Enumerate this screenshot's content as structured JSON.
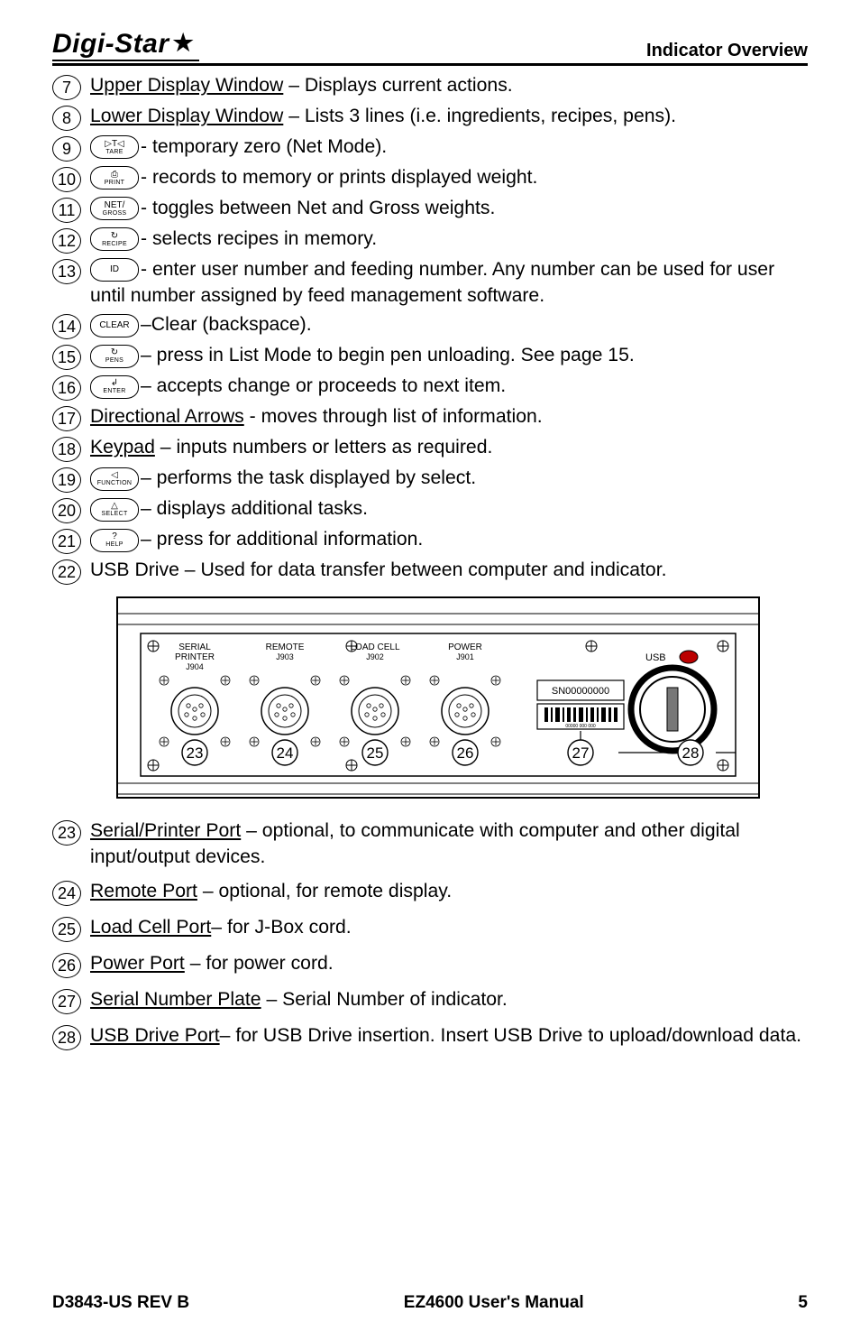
{
  "header": {
    "brand": "Digi-Star",
    "section": "Indicator Overview"
  },
  "items": [
    {
      "n": "7",
      "lead_u": "Upper Display Window",
      "sep": " – ",
      "rest": "Displays current actions.",
      "key": null
    },
    {
      "n": "8",
      "lead_u": "Lower Display Window",
      "sep": " – ",
      "rest": "Lists 3 lines (i.e. ingredients, recipes, pens).",
      "key": null
    },
    {
      "n": "9",
      "key": {
        "top": "▷T◁",
        "sub": "TARE"
      },
      "sep": "- ",
      "rest": "temporary zero (Net Mode)."
    },
    {
      "n": "10",
      "key": {
        "top": "⎙",
        "sub": "PRINT"
      },
      "sep": "- ",
      "rest": "records to memory or prints displayed weight."
    },
    {
      "n": "11",
      "key": {
        "top": "NET/",
        "sub": "GROSS"
      },
      "sep": "- ",
      "rest": "toggles between Net and Gross weights."
    },
    {
      "n": "12",
      "key": {
        "top": "↻",
        "sub": "RECIPE"
      },
      "sep": "- ",
      "rest": "selects recipes in memory."
    },
    {
      "n": "13",
      "key": {
        "top": "ID",
        "sub": ""
      },
      "sep": "- ",
      "rest": "enter user number and feeding number. Any number can be used for user until number assigned by feed management software."
    },
    {
      "n": "14",
      "key": {
        "top": "CLEAR",
        "sub": ""
      },
      "sep": "–",
      "rest": "Clear (backspace)."
    },
    {
      "n": "15",
      "key": {
        "top": "↻",
        "sub": "PENS"
      },
      "sep": "– ",
      "rest": "press in List Mode to begin pen unloading. See page 15."
    },
    {
      "n": "16",
      "key": {
        "top": "↲",
        "sub": "ENTER"
      },
      "sep": "– ",
      "rest": "accepts change or proceeds to next item."
    },
    {
      "n": "17",
      "lead_u": "Directional Arrows",
      "sep": " - ",
      "rest": "moves through list of information.",
      "key": null
    },
    {
      "n": "18",
      "lead_u": "Keypad",
      "sep": " – ",
      "rest": "inputs numbers or letters as required.",
      "key": null
    },
    {
      "n": "19",
      "key": {
        "top": "◁",
        "sub": "FUNCTION"
      },
      "sep": "– ",
      "rest": "performs the task displayed by select."
    },
    {
      "n": "20",
      "key": {
        "top": "△",
        "sub": "SELECT"
      },
      "sep": "– ",
      "rest": "displays additional tasks."
    },
    {
      "n": "21",
      "key": {
        "top": "?",
        "sub": "HELP"
      },
      "sep": "– ",
      "rest": "press for additional information."
    },
    {
      "n": "22",
      "plain": "USB Drive – Used for data transfer between computer and indicator."
    }
  ],
  "diagram": {
    "ports": [
      {
        "num": "23",
        "label1": "SERIAL",
        "label2": "PRINTER",
        "j": "J904"
      },
      {
        "num": "24",
        "label1": "REMOTE",
        "label2": "",
        "j": "J903"
      },
      {
        "num": "25",
        "label1": "LOAD CELL",
        "label2": "",
        "j": "J902"
      },
      {
        "num": "26",
        "label1": "POWER",
        "label2": "",
        "j": "J901"
      }
    ],
    "serial_plate": {
      "num": "27",
      "sn": "SN00000000"
    },
    "usb": {
      "num": "28",
      "label": "USB"
    }
  },
  "items2": [
    {
      "n": "23",
      "lead_u": "Serial/Printer Port",
      "sep": " – ",
      "rest": "optional, to communicate with computer and other digital input/output devices."
    },
    {
      "n": "24",
      "lead_u": "Remote Port",
      "sep": " – ",
      "rest": "optional, for remote display."
    },
    {
      "n": "25",
      "lead_u": "Load Cell Port",
      "sep": "– ",
      "rest": "for J-Box cord."
    },
    {
      "n": "26",
      "lead_u": "Power Port",
      "sep": " – ",
      "rest": "for power cord."
    },
    {
      "n": "27",
      "lead_u": "Serial Number Plate",
      "sep": " – ",
      "rest": "Serial Number of indicator."
    },
    {
      "n": "28",
      "lead_u": "USB Drive Port",
      "sep": "– ",
      "rest": "for USB Drive insertion. Insert USB Drive to upload/download data."
    }
  ],
  "footer": {
    "left": "D3843-US REV B",
    "center": "EZ4600 User's Manual",
    "right": "5"
  }
}
